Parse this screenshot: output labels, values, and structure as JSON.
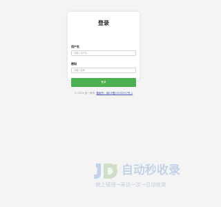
{
  "login": {
    "title": "登录",
    "username_label": "用户名",
    "username_placeholder": "请输入用户名",
    "password_label": "密码",
    "password_placeholder": "请输入密码",
    "submit_label": "登录"
  },
  "footer": {
    "copyright": "© 2024 前一城市,",
    "icp_link": "备案号：闽ICP备19032957号-1"
  },
  "watermark": {
    "title": "自动秒收录",
    "subtitle": "做上链接→来访一次→自动收录"
  },
  "colors": {
    "button": "#4caf50",
    "link": "#3b56b0",
    "background": "#f4f4f4"
  }
}
